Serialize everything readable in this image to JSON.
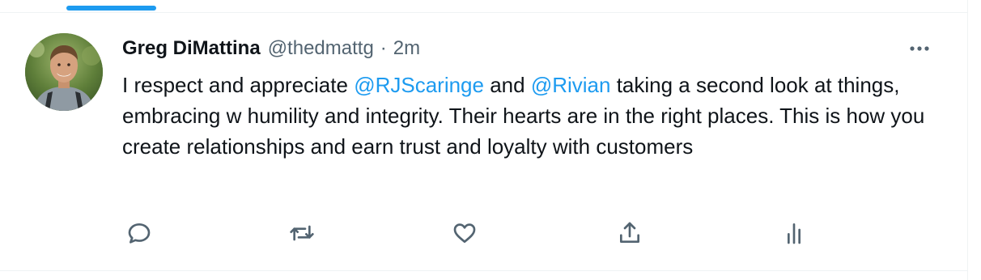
{
  "tweet": {
    "display_name": "Greg DiMattina",
    "handle": "@thedmattg",
    "separator": "·",
    "timestamp": "2m",
    "text_parts": {
      "p1": "I respect and appreciate ",
      "mention1": "@RJScaringe",
      "p2": " and ",
      "mention2": "@Rivian",
      "p3": " taking a second look at things, embracing w humility and integrity. Their hearts are in the right places. This is how you create relationships and earn trust and loyalty with customers"
    }
  },
  "actions": [
    {
      "name": "reply",
      "icon": "reply-icon"
    },
    {
      "name": "retweet",
      "icon": "retweet-icon"
    },
    {
      "name": "like",
      "icon": "heart-icon"
    },
    {
      "name": "share",
      "icon": "share-icon"
    },
    {
      "name": "analytics",
      "icon": "analytics-icon"
    }
  ],
  "colors": {
    "accent": "#1d9bf0",
    "text_primary": "#0f1419",
    "text_secondary": "#536471",
    "divider": "#eff3f4"
  }
}
